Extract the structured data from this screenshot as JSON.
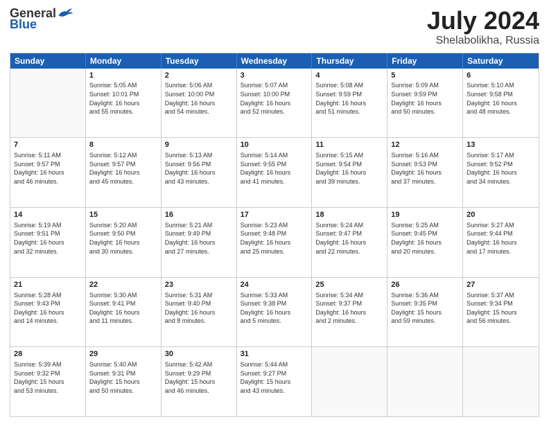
{
  "logo": {
    "general": "General",
    "blue": "Blue"
  },
  "title": "July 2024",
  "location": "Shelabolikha, Russia",
  "weekdays": [
    "Sunday",
    "Monday",
    "Tuesday",
    "Wednesday",
    "Thursday",
    "Friday",
    "Saturday"
  ],
  "weeks": [
    [
      {
        "day": "",
        "info": ""
      },
      {
        "day": "1",
        "info": "Sunrise: 5:05 AM\nSunset: 10:01 PM\nDaylight: 16 hours\nand 55 minutes."
      },
      {
        "day": "2",
        "info": "Sunrise: 5:06 AM\nSunset: 10:00 PM\nDaylight: 16 hours\nand 54 minutes."
      },
      {
        "day": "3",
        "info": "Sunrise: 5:07 AM\nSunset: 10:00 PM\nDaylight: 16 hours\nand 52 minutes."
      },
      {
        "day": "4",
        "info": "Sunrise: 5:08 AM\nSunset: 9:59 PM\nDaylight: 16 hours\nand 51 minutes."
      },
      {
        "day": "5",
        "info": "Sunrise: 5:09 AM\nSunset: 9:59 PM\nDaylight: 16 hours\nand 50 minutes."
      },
      {
        "day": "6",
        "info": "Sunrise: 5:10 AM\nSunset: 9:58 PM\nDaylight: 16 hours\nand 48 minutes."
      }
    ],
    [
      {
        "day": "7",
        "info": "Sunrise: 5:11 AM\nSunset: 9:57 PM\nDaylight: 16 hours\nand 46 minutes."
      },
      {
        "day": "8",
        "info": "Sunrise: 5:12 AM\nSunset: 9:57 PM\nDaylight: 16 hours\nand 45 minutes."
      },
      {
        "day": "9",
        "info": "Sunrise: 5:13 AM\nSunset: 9:56 PM\nDaylight: 16 hours\nand 43 minutes."
      },
      {
        "day": "10",
        "info": "Sunrise: 5:14 AM\nSunset: 9:55 PM\nDaylight: 16 hours\nand 41 minutes."
      },
      {
        "day": "11",
        "info": "Sunrise: 5:15 AM\nSunset: 9:54 PM\nDaylight: 16 hours\nand 39 minutes."
      },
      {
        "day": "12",
        "info": "Sunrise: 5:16 AM\nSunset: 9:53 PM\nDaylight: 16 hours\nand 37 minutes."
      },
      {
        "day": "13",
        "info": "Sunrise: 5:17 AM\nSunset: 9:52 PM\nDaylight: 16 hours\nand 34 minutes."
      }
    ],
    [
      {
        "day": "14",
        "info": "Sunrise: 5:19 AM\nSunset: 9:51 PM\nDaylight: 16 hours\nand 32 minutes."
      },
      {
        "day": "15",
        "info": "Sunrise: 5:20 AM\nSunset: 9:50 PM\nDaylight: 16 hours\nand 30 minutes."
      },
      {
        "day": "16",
        "info": "Sunrise: 5:21 AM\nSunset: 9:49 PM\nDaylight: 16 hours\nand 27 minutes."
      },
      {
        "day": "17",
        "info": "Sunrise: 5:23 AM\nSunset: 9:48 PM\nDaylight: 16 hours\nand 25 minutes."
      },
      {
        "day": "18",
        "info": "Sunrise: 5:24 AM\nSunset: 9:47 PM\nDaylight: 16 hours\nand 22 minutes."
      },
      {
        "day": "19",
        "info": "Sunrise: 5:25 AM\nSunset: 9:45 PM\nDaylight: 16 hours\nand 20 minutes."
      },
      {
        "day": "20",
        "info": "Sunrise: 5:27 AM\nSunset: 9:44 PM\nDaylight: 16 hours\nand 17 minutes."
      }
    ],
    [
      {
        "day": "21",
        "info": "Sunrise: 5:28 AM\nSunset: 9:43 PM\nDaylight: 16 hours\nand 14 minutes."
      },
      {
        "day": "22",
        "info": "Sunrise: 5:30 AM\nSunset: 9:41 PM\nDaylight: 16 hours\nand 11 minutes."
      },
      {
        "day": "23",
        "info": "Sunrise: 5:31 AM\nSunset: 9:40 PM\nDaylight: 16 hours\nand 8 minutes."
      },
      {
        "day": "24",
        "info": "Sunrise: 5:33 AM\nSunset: 9:38 PM\nDaylight: 16 hours\nand 5 minutes."
      },
      {
        "day": "25",
        "info": "Sunrise: 5:34 AM\nSunset: 9:37 PM\nDaylight: 16 hours\nand 2 minutes."
      },
      {
        "day": "26",
        "info": "Sunrise: 5:36 AM\nSunset: 9:35 PM\nDaylight: 15 hours\nand 59 minutes."
      },
      {
        "day": "27",
        "info": "Sunrise: 5:37 AM\nSunset: 9:34 PM\nDaylight: 15 hours\nand 56 minutes."
      }
    ],
    [
      {
        "day": "28",
        "info": "Sunrise: 5:39 AM\nSunset: 9:32 PM\nDaylight: 15 hours\nand 53 minutes."
      },
      {
        "day": "29",
        "info": "Sunrise: 5:40 AM\nSunset: 9:31 PM\nDaylight: 15 hours\nand 50 minutes."
      },
      {
        "day": "30",
        "info": "Sunrise: 5:42 AM\nSunset: 9:29 PM\nDaylight: 15 hours\nand 46 minutes."
      },
      {
        "day": "31",
        "info": "Sunrise: 5:44 AM\nSunset: 9:27 PM\nDaylight: 15 hours\nand 43 minutes."
      },
      {
        "day": "",
        "info": ""
      },
      {
        "day": "",
        "info": ""
      },
      {
        "day": "",
        "info": ""
      }
    ]
  ]
}
